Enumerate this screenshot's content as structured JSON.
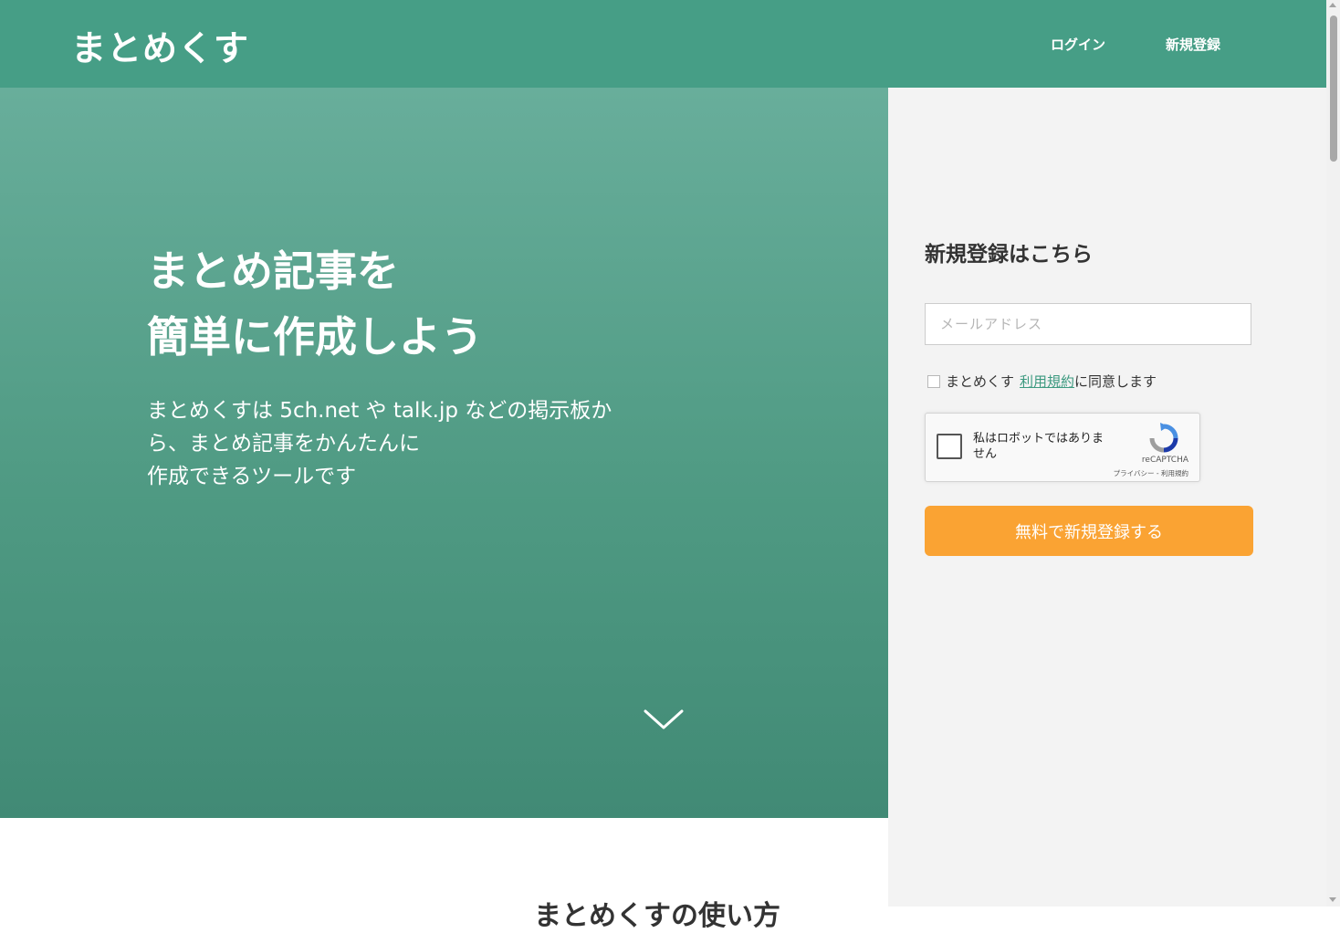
{
  "header": {
    "logo": "まとめくす",
    "nav": {
      "login": "ログイン",
      "register": "新規登録"
    }
  },
  "hero": {
    "title_line1": "まとめ記事を",
    "title_line2": "簡単に作成しよう",
    "desc_line1": "まとめくすは 5ch.net や talk.jp などの掲示板か",
    "desc_line2": "ら、まとめ記事をかんたんに",
    "desc_line3": "作成できるツールです",
    "scroll_icon": "chevron-down-icon"
  },
  "section": {
    "title": "まとめくすの使い方"
  },
  "signup": {
    "title": "新規登録はこちら",
    "email_placeholder": "メールアドレス",
    "email_value": "",
    "agree_prefix": "まとめくす",
    "agree_link": "利用規約",
    "agree_suffix": "に同意します",
    "agree_checked": false,
    "recaptcha": {
      "label": "私はロボットではありません",
      "brand": "reCAPTCHA",
      "legal": "プライバシー - 利用規約"
    },
    "submit": "無料で新規登録する"
  },
  "colors": {
    "header": "#469e86",
    "hero_top": "#68ae9b",
    "hero_bottom": "#418a75",
    "side_bg": "#f3f3f3",
    "accent_link": "#3d9a80",
    "submit": "#faa333"
  }
}
